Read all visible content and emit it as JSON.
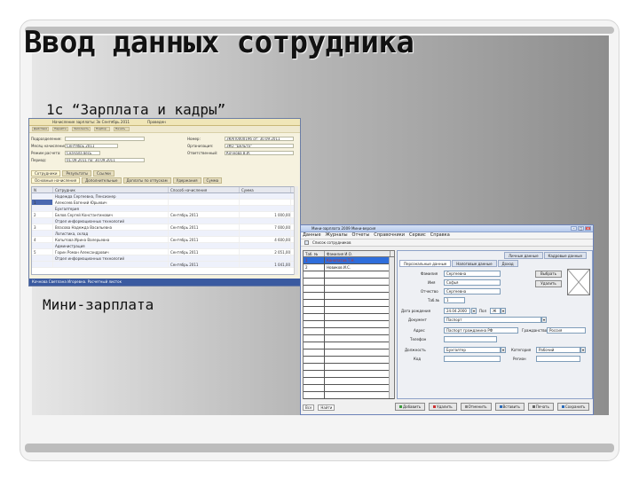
{
  "slide": {
    "title": "Ввод данных сотрудника",
    "label_1c": "1с “Зарплата и кадры”",
    "label_mini": "Мини-зарплата"
  },
  "win1": {
    "title_parts": [
      "Начисление зарплаты: Зк Сентябрь 2011",
      "Проведен"
    ],
    "toolbar": [
      "Действия",
      "Перейти",
      "Заполнить",
      "Подбор",
      "Печать"
    ],
    "form_left": [
      {
        "label": "Подразделение:",
        "value": ""
      },
      {
        "label": "Месяц начисления:",
        "value": "Сентябрь 2011"
      },
      {
        "label": "Режим расчета:",
        "value": "Сначала весь"
      },
      {
        "label": "Период:",
        "value": "01.09.2011  по: 30.09.2011"
      }
    ],
    "form_right": [
      {
        "label": "Номер:",
        "value": "ЗКАП0000196   от: 30.09.2011"
      },
      {
        "label": "Организация:",
        "value": "ЗКО \"Дельта\""
      },
      {
        "label": "Ответственный:",
        "value": "Кочнова В.И."
      }
    ],
    "tabs": [
      "Сотрудники",
      "Результаты",
      "Ссылки"
    ],
    "subtabs": [
      "Основные начисления",
      "Дополнительные",
      "Доплаты по отпускам",
      "Удержания",
      "Сумма"
    ],
    "grid_headers": [
      "N",
      "Сотрудник",
      "Способ начисления",
      "Сумма"
    ],
    "grid_rows": [
      {
        "n": "",
        "name": "Надежда Сергеевна, Пенсионер",
        "month": "",
        "sum": ""
      },
      {
        "n": "1",
        "name": "Алексеев Евгений Юрьевич",
        "month": "",
        "sum": ""
      },
      {
        "n": "",
        "name": "Бухгалтерия",
        "month": "",
        "sum": ""
      },
      {
        "n": "2",
        "name": "Белов Сергей Константинович",
        "month": "Сентябрь 2011",
        "sum": "1 000,00"
      },
      {
        "n": "",
        "name": "Отдел информационных технологий",
        "month": "",
        "sum": ""
      },
      {
        "n": "3",
        "name": "Власова Надежда Васильевна",
        "month": "Сентябрь 2011",
        "sum": "7 000,00"
      },
      {
        "n": "",
        "name": "Логистика, склад",
        "month": "",
        "sum": ""
      },
      {
        "n": "4",
        "name": "Копытова Ирина Валерьевна",
        "month": "Сентябрь 2011",
        "sum": "4 600,00"
      },
      {
        "n": "",
        "name": "Администрация",
        "month": "",
        "sum": ""
      },
      {
        "n": "5",
        "name": "Горин Роман Александрович",
        "month": "Сентябрь 2011",
        "sum": "2 051,00"
      },
      {
        "n": "",
        "name": "Отдел информационных технологий",
        "month": "",
        "sum": ""
      },
      {
        "n": "",
        "name": "",
        "month": "Сентябрь 2011",
        "sum": "1 041,00"
      }
    ],
    "status": "Кочнова Светлана Игоревна. Расчетный листок"
  },
  "win2": {
    "title": "Мини-зарплата 2009 Мини-версия",
    "menu": [
      "Данные",
      "Журналы",
      "Отчеты",
      "Справочники",
      "Сервис",
      "Справка"
    ],
    "tool_label": "Список сотрудников",
    "left_headers": [
      "Таб. №",
      "Фамилия И.О."
    ],
    "left_rows": [
      {
        "tab": "1",
        "name": "Конопатов Т.Н."
      },
      {
        "tab": "2",
        "name": "Новиков И.С."
      }
    ],
    "left_footer": [
      "Все",
      "Найти",
      "Отмена"
    ],
    "tabs_row1": [
      "Личные данные",
      "Кадровые данные"
    ],
    "tabs_row2": [
      "Персональные данные",
      "Налоговые данные",
      "Доход"
    ],
    "fields": {
      "surname_label": "Фамилия",
      "surname": "Сергеевна",
      "name_label": "Имя",
      "name": "Софья",
      "patronymic_label": "Отчество",
      "patronymic": "Сергеевна",
      "tabno_label": "Таб.№",
      "tabno": "1",
      "birth_label": "Дата рождения",
      "birth": "24.04.2000",
      "doc_label": "Документ",
      "doc": "Паспорт",
      "pol_label": "Пол",
      "pol": "Ж",
      "sex_label": "Пол",
      "addr_label": "Адрес",
      "addr": "Паспорт гражданина РФ",
      "grazh_label": "Гражданство",
      "grazh": "Россия",
      "phone_label": "Телефон",
      "phone": "",
      "inn_label": "ИНН",
      "inn": "",
      "position_label": "Должность",
      "position": "Бухгалтер",
      "kategory_label": "Категория",
      "kategory": "Рабочий",
      "kod_label": "Код",
      "kod": "",
      "reg_label": "Регион",
      "reg": ""
    },
    "side_buttons": [
      "Выбрать",
      "Удалить"
    ],
    "bottom_buttons": [
      "Добавить",
      "Удалить",
      "Отменить",
      "Вставить",
      "Печать",
      "Сохранить"
    ]
  }
}
